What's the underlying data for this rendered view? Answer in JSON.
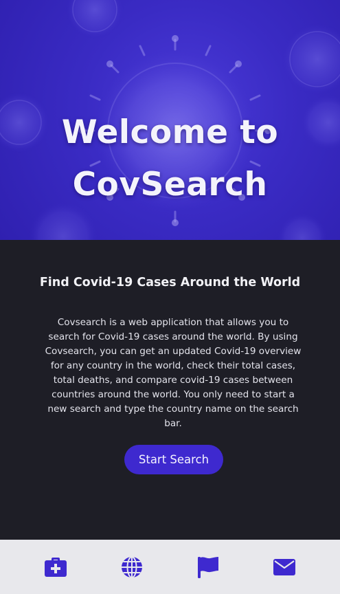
{
  "hero": {
    "title_line1": "Welcome to",
    "title_line2": "CovSearch"
  },
  "main": {
    "subtitle": "Find Covid-19 Cases Around the World",
    "description": "Covsearch is a web application that allows you to search for Covid-19 cases around the world. By using Covsearch, you can get an updated Covid-19 overview for any country in the world, check their total cases, total deaths, and compare covid-19 cases between countries around the world. You only need to start a new search and type the country name on the search bar.",
    "start_button_label": "Start Search"
  },
  "bottom_nav": {
    "items": [
      {
        "icon": "medical-kit-icon"
      },
      {
        "icon": "globe-icon"
      },
      {
        "icon": "flag-icon"
      },
      {
        "icon": "envelope-icon"
      }
    ]
  },
  "colors": {
    "accent": "#3e29cf",
    "hero_background": "#3a2bc4",
    "content_background": "#1e1e26",
    "nav_background": "#e8e8ec",
    "nav_icon": "#3e29cf"
  }
}
